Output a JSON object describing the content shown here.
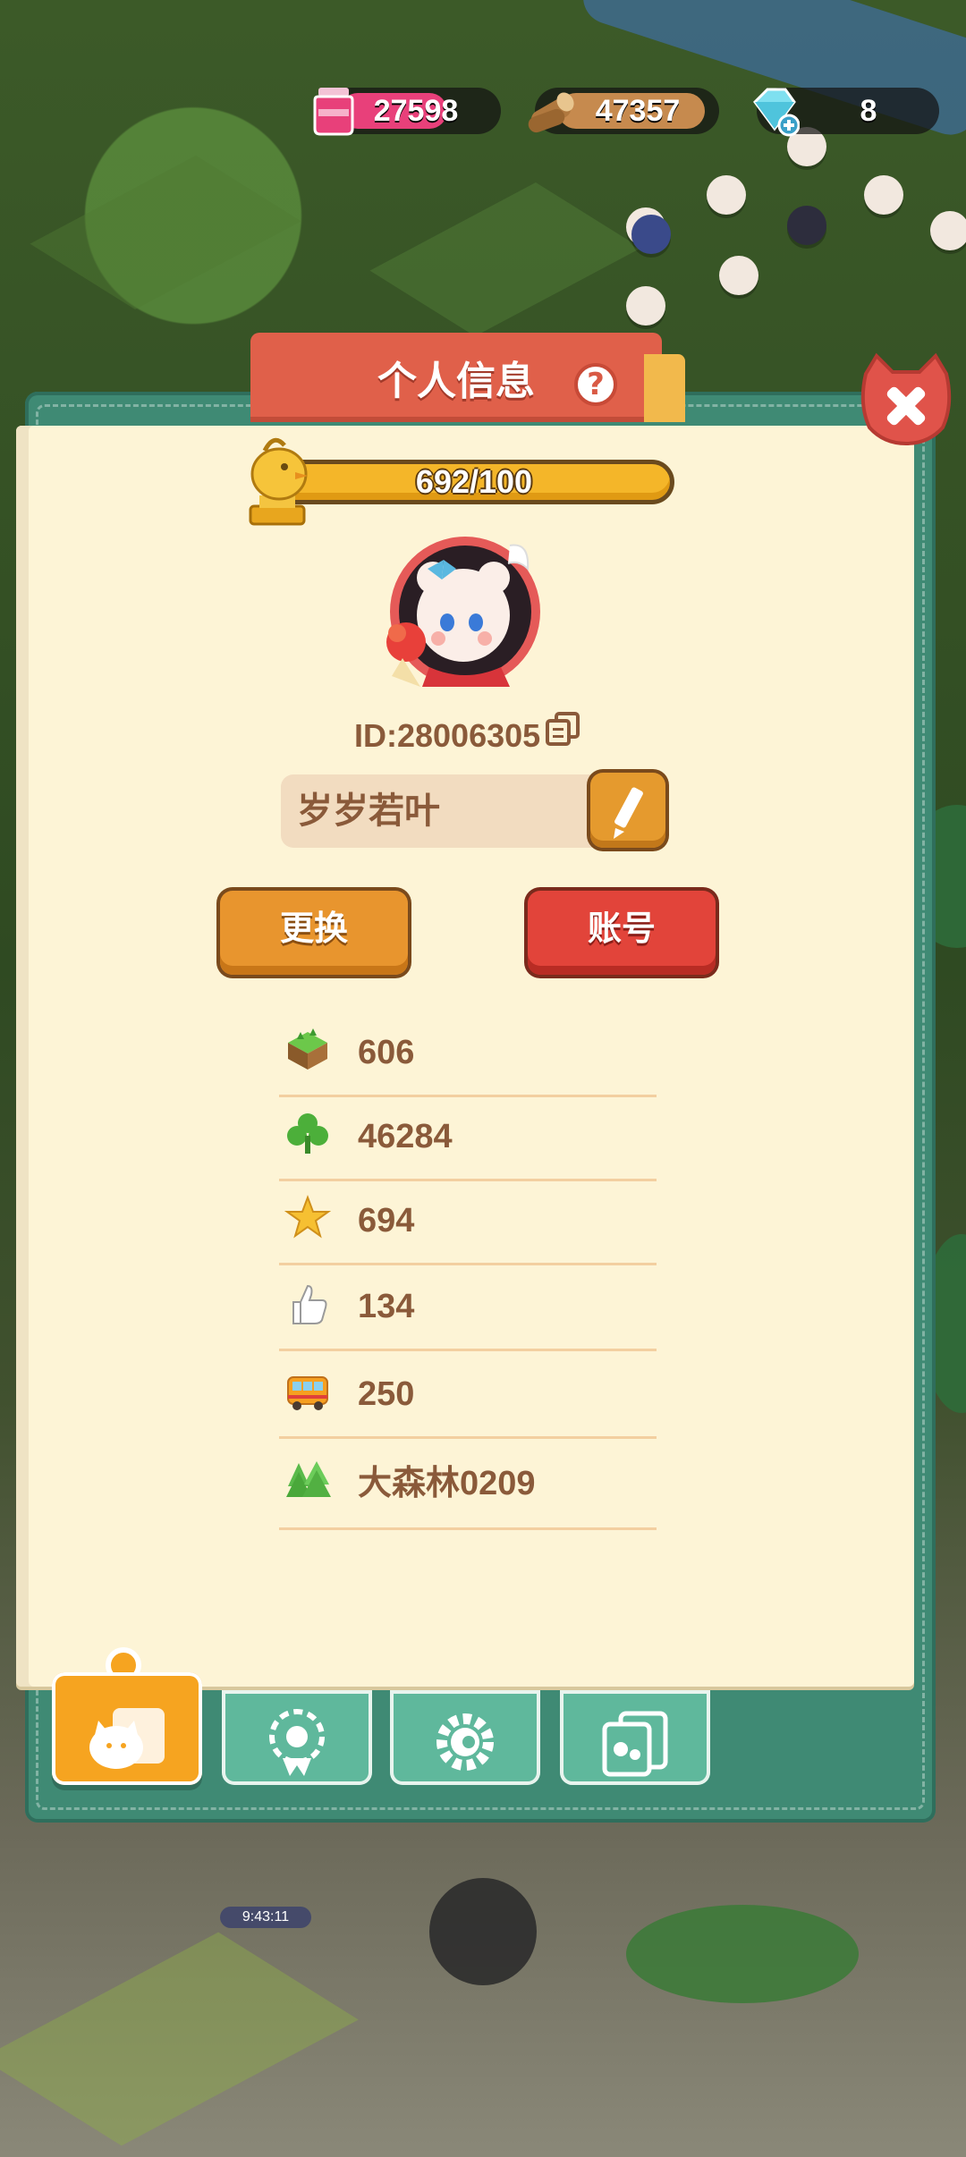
{
  "resources": {
    "potion": {
      "value": "27598",
      "icon": "potion-jar-icon",
      "color": "#e8407a"
    },
    "wood": {
      "value": "47357",
      "icon": "wood-log-icon",
      "color": "#c68a4e"
    },
    "gem": {
      "value": "8",
      "icon": "diamond-plus-icon",
      "color": "#7fe0f0"
    }
  },
  "panel": {
    "title": "个人信息",
    "help_label": "?",
    "exp": {
      "text": "692/100",
      "progress": 1.0
    },
    "user_id": "ID:28006305",
    "nickname": "岁岁若叶",
    "change_button": "更换",
    "account_button": "账号"
  },
  "stats": [
    {
      "icon": "grass-block-icon",
      "value": "606"
    },
    {
      "icon": "clover-icon",
      "value": "46284"
    },
    {
      "icon": "star-icon",
      "value": "694"
    },
    {
      "icon": "thumbs-up-icon",
      "value": "134"
    },
    {
      "icon": "bus-icon",
      "value": "250"
    },
    {
      "icon": "pine-trees-icon",
      "value": "大森林0209"
    }
  ],
  "tabs": [
    {
      "name": "tab-profile",
      "icon": "cat-card-icon",
      "active": true
    },
    {
      "name": "tab-badges",
      "icon": "flower-badge-icon",
      "active": false
    },
    {
      "name": "tab-settings",
      "icon": "gear-icon",
      "active": false
    },
    {
      "name": "tab-album",
      "icon": "photo-album-icon",
      "active": false
    }
  ],
  "world": {
    "timer": "9:43:11"
  },
  "colors": {
    "panel_frame": "#3f8a74",
    "page": "#fdf4d6",
    "title_tab": "#e0604a",
    "accent_orange": "#e8952e",
    "accent_red": "#e2443a",
    "text_brown": "#8a5a3a"
  }
}
